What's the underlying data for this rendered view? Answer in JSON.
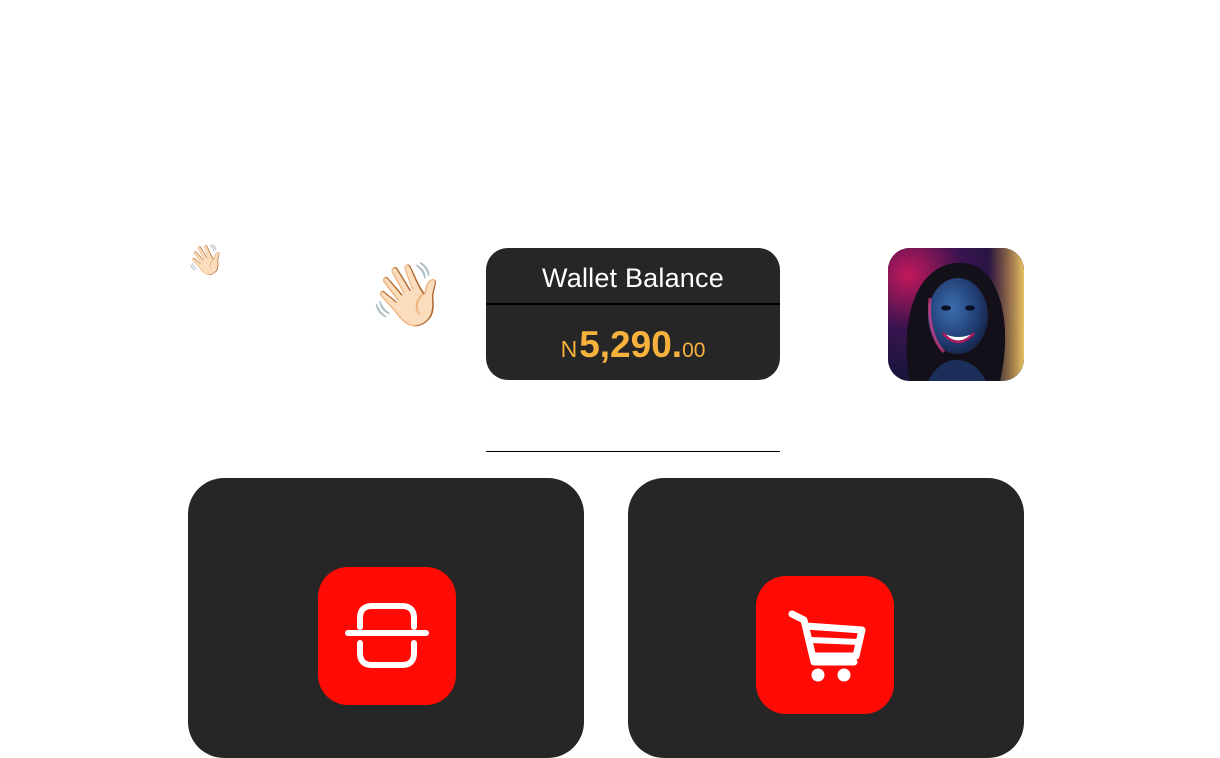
{
  "greeting": {
    "wave_emoji": "👋🏻",
    "wave_emoji_large": "👋🏻"
  },
  "wallet": {
    "title": "Wallet Balance",
    "currency_symbol": "N",
    "amount_main": "5,290.",
    "amount_cents": "00"
  },
  "profile": {
    "avatar_icon": "user-avatar-photo"
  },
  "actions": [
    {
      "icon": "scan-icon"
    },
    {
      "icon": "shopping-cart-icon"
    }
  ],
  "colors": {
    "card_background": "#262626",
    "accent_red": "#ff0a05",
    "balance_gold": "#f6b23c",
    "text_white": "#ffffff"
  }
}
